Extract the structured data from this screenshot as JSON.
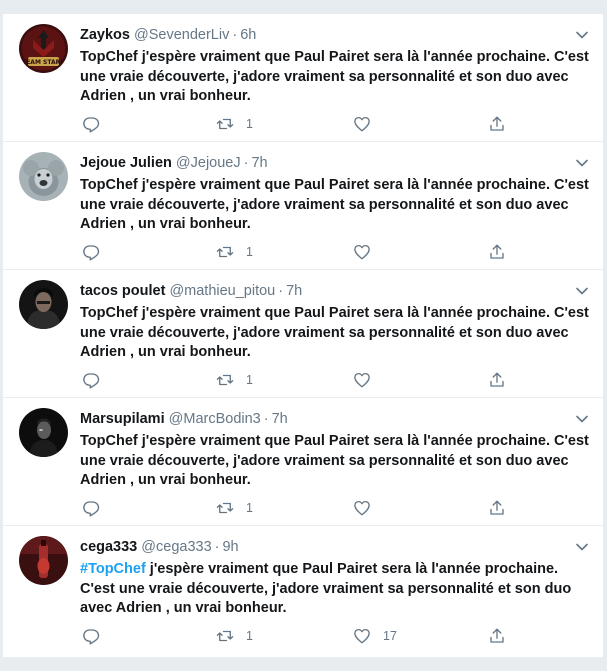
{
  "tweets": [
    {
      "name": "Zaykos",
      "handle": "@SevenderLiv",
      "separator": "·",
      "time": "6h",
      "hashtag": "",
      "text": "TopChef j'espère vraiment que Paul Pairet sera là l'année prochaine. C'est une vraie découverte, j'adore vraiment sa personnalité et son duo avec Adrien , un vrai bonheur.",
      "replies": "",
      "retweets": "1",
      "likes": "",
      "avatar_text": "TEAM STARK"
    },
    {
      "name": "Jejoue Julien",
      "handle": "@JejoueJ",
      "separator": "·",
      "time": "7h",
      "hashtag": "",
      "text": "TopChef j'espère vraiment que Paul Pairet sera là l'année prochaine. C'est une vraie découverte, j'adore vraiment sa personnalité et son duo avec Adrien , un vrai bonheur.",
      "replies": "",
      "retweets": "1",
      "likes": ""
    },
    {
      "name": "tacos poulet",
      "handle": "@mathieu_pitou",
      "separator": "·",
      "time": "7h",
      "hashtag": "",
      "text": "TopChef j'espère vraiment que Paul Pairet sera là l'année prochaine. C'est une vraie découverte, j'adore vraiment sa personnalité et son duo avec Adrien , un vrai bonheur.",
      "replies": "",
      "retweets": "1",
      "likes": ""
    },
    {
      "name": "Marsupilami",
      "handle": "@MarcBodin3",
      "separator": "·",
      "time": "7h",
      "hashtag": "",
      "text": "TopChef j'espère vraiment que Paul Pairet sera là l'année prochaine. C'est une vraie découverte, j'adore vraiment sa personnalité et son duo avec Adrien , un vrai bonheur.",
      "replies": "",
      "retweets": "1",
      "likes": ""
    },
    {
      "name": "cega333",
      "handle": "@cega333",
      "separator": "·",
      "time": "9h",
      "hashtag": "#TopChef",
      "text": " j'espère vraiment que Paul Pairet sera là l'année prochaine. C'est une vraie découverte, j'adore vraiment sa personnalité et son duo avec Adrien , un vrai bonheur.",
      "replies": "",
      "retweets": "1",
      "likes": "17"
    }
  ],
  "icons": {
    "reply": "reply-icon",
    "retweet": "retweet-icon",
    "like": "like-icon",
    "share": "share-icon",
    "more": "chevron-down-icon"
  },
  "colors": {
    "muted": "#657786",
    "text": "#14171a",
    "link": "#1da1f2",
    "divider": "#e6ecf0"
  }
}
